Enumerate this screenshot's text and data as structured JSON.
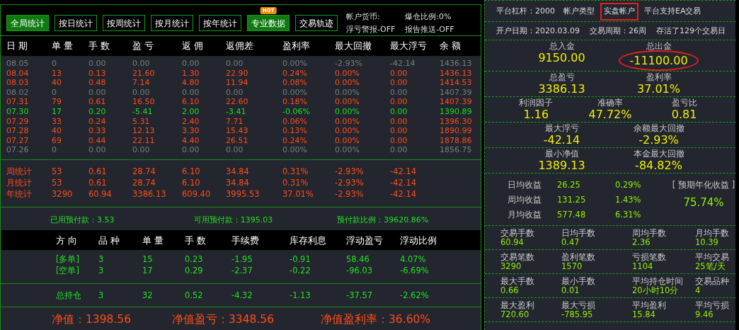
{
  "toolbar": {
    "tabs": [
      {
        "label": "全局统计",
        "selected": true
      },
      {
        "label": "按日统计",
        "selected": false
      },
      {
        "label": "按周统计",
        "selected": false
      },
      {
        "label": "按月统计",
        "selected": false
      },
      {
        "label": "按年统计",
        "selected": false
      },
      {
        "label": "专业数据",
        "selected": true,
        "badge": "HOT"
      },
      {
        "label": "交易轨迹",
        "selected": false
      }
    ],
    "info": [
      "帐户货币:",
      "爆仓比例:0%",
      "浮亏警报-OFF",
      "报告推送-OFF"
    ]
  },
  "daily_table": {
    "columns": [
      "日 期",
      "单 量",
      "手 数",
      "盈 亏",
      "返 佣",
      "返佣差",
      "盈利率",
      "最大回撤",
      "最大浮亏",
      "余 额"
    ],
    "rows": [
      {
        "kind": "flat",
        "cells": [
          "08.05",
          "0",
          "0.00",
          "0.00",
          "0.00",
          "0.00",
          "0.00%",
          "-2.93%",
          "-42.14",
          "1436.13"
        ]
      },
      {
        "kind": "gain",
        "cells": [
          "08.04",
          "13",
          "0.13",
          "21.60",
          "1.30",
          "22.90",
          "0.24%",
          "0.00%",
          "0.00",
          "1436.13"
        ]
      },
      {
        "kind": "gain",
        "cells": [
          "08.03",
          "40",
          "0.48",
          "7.14",
          "4.80",
          "11.94",
          "0.08%",
          "0.00%",
          "0.00",
          "1414.53"
        ]
      },
      {
        "kind": "flat",
        "cells": [
          "08.02",
          "0",
          "0.00",
          "0.00",
          "0.00",
          "0.00",
          "0.00%",
          "0.00%",
          "0.00",
          "1407.39"
        ]
      },
      {
        "kind": "gain",
        "cells": [
          "07.31",
          "79",
          "0.61",
          "16.50",
          "6.10",
          "22.60",
          "0.18%",
          "0.00%",
          "0.00",
          "1407.39"
        ]
      },
      {
        "kind": "loss",
        "cells": [
          "07.30",
          "17",
          "0.20",
          "-5.41",
          "2.00",
          "-3.41",
          "-0.06%",
          "0.00%",
          "0.00",
          "1390.89"
        ]
      },
      {
        "kind": "gain",
        "cells": [
          "07.29",
          "33",
          "0.24",
          "5.31",
          "2.40",
          "7.71",
          "0.06%",
          "0.00%",
          "0.00",
          "1396.30"
        ]
      },
      {
        "kind": "gain",
        "cells": [
          "07.28",
          "40",
          "0.33",
          "12.13",
          "3.30",
          "15.43",
          "0.13%",
          "0.00%",
          "0.00",
          "1890.99"
        ]
      },
      {
        "kind": "gain",
        "cells": [
          "07.27",
          "69",
          "0.44",
          "22.11",
          "4.40",
          "26.51",
          "0.24%",
          "0.00%",
          "0.00",
          "1878.86"
        ]
      },
      {
        "kind": "flat",
        "cells": [
          "07.26",
          "0",
          "0.00",
          "0.00",
          "0.00",
          "0.00",
          "0.00%",
          "0.00%",
          "0.00",
          "1856.75"
        ]
      }
    ],
    "summary": [
      {
        "cells": [
          "周统计",
          "53",
          "0.61",
          "28.74",
          "6.10",
          "34.84",
          "0.31%",
          "-2.93%",
          "-42.14"
        ]
      },
      {
        "cells": [
          "月统计",
          "53",
          "0.61",
          "28.74",
          "6.10",
          "34.84",
          "0.31%",
          "-2.93%",
          "-42.14"
        ]
      },
      {
        "cells": [
          "年统计",
          "3290",
          "60.94",
          "3386.13",
          "609.40",
          "3995.53",
          "37.01%",
          "-2.93%",
          "-42.14"
        ]
      }
    ]
  },
  "prepaid": [
    "已用预付款：3.53",
    "可用预付款：1395.03",
    "预付款比例：39620.86%"
  ],
  "positions": {
    "columns": [
      "方 向",
      "品 种",
      "单 量",
      "手 数",
      "手续费",
      "库存利息",
      "浮动盈亏",
      "浮动比例"
    ],
    "rows": [
      {
        "cells": [
          "[多单]",
          "3",
          "15",
          "0.23",
          "-1.95",
          "-0.91",
          "58.46",
          "4.07%"
        ]
      },
      {
        "cells": [
          "[空单]",
          "3",
          "17",
          "0.29",
          "-2.37",
          "-0.22",
          "-96.03",
          "-6.69%"
        ]
      }
    ],
    "total": {
      "cells": [
        "总持仓",
        "3",
        "32",
        "0.52",
        "-4.32",
        "-1.13",
        "-37.57",
        "-2.62%"
      ]
    }
  },
  "net": [
    "净值：1398.56",
    "净值盈亏：3348.56",
    "净值盈利率：36.60%"
  ],
  "account": {
    "header": [
      {
        "text": "平台杠杆：2000",
        "boxed": false
      },
      {
        "text": "帐户类型",
        "boxed": false
      },
      {
        "text": "实盘帐户",
        "boxed": true
      },
      {
        "text": "平台支持EA交易",
        "boxed": false
      }
    ],
    "dates": [
      "开户日期：2020.03.09",
      "交易周期：26周",
      "存活了129个交易日"
    ],
    "big_stats": [
      [
        {
          "label": "总入金",
          "value": "9150.00",
          "circled": false
        },
        {
          "label": "总出金",
          "value": "-11100.00",
          "circled": true
        }
      ],
      [
        {
          "label": "总盈亏",
          "value": "3386.13",
          "circled": false
        },
        {
          "label": "盈利率",
          "value": "37.01%",
          "circled": false
        }
      ],
      [
        {
          "label": "利润因子",
          "value": "1.16",
          "circled": false
        },
        {
          "label": "准确率",
          "value": "47.72%",
          "circled": false
        },
        {
          "label": "盈亏比",
          "value": "0.81",
          "circled": false
        }
      ],
      [
        {
          "label": "最大浮亏",
          "value": "-42.14",
          "circled": false
        },
        {
          "label": "余额最大回撤",
          "value": "-2.93%",
          "circled": false
        }
      ],
      [
        {
          "label": "最小净值",
          "value": "1389.13",
          "circled": false
        },
        {
          "label": "本金最大回撤",
          "value": "-84.82%",
          "circled": false
        }
      ]
    ],
    "averages": [
      {
        "label": "日均收益",
        "amount": "26.25",
        "percent": "0.29%"
      },
      {
        "label": "周均收益",
        "amount": "131.25",
        "percent": "1.43%"
      },
      {
        "label": "月均收益",
        "amount": "577.48",
        "percent": "6.31%"
      }
    ],
    "forecast": {
      "label": "[ 预期年化收益 ]",
      "value": "75.74%"
    },
    "counts": [
      [
        {
          "label": "交易手数",
          "value": "60.94"
        },
        {
          "label": "日均手数",
          "value": "0.47"
        },
        {
          "label": "周均手数",
          "value": "2.36"
        },
        {
          "label": "月均手数",
          "value": "10.39"
        }
      ],
      [
        {
          "label": "交易笔数",
          "value": "3290"
        },
        {
          "label": "盈利笔数",
          "value": "1570"
        },
        {
          "label": "亏损笔数",
          "value": "1104"
        },
        {
          "label": "平均交易",
          "value": "25笔/天"
        }
      ],
      [
        {
          "label": "最大手数",
          "value": "0.66"
        },
        {
          "label": "最小手数",
          "value": "0.01"
        },
        {
          "label": "平均持仓时间",
          "value": "20小时10分"
        },
        {
          "label": "交易品种",
          "value": "4"
        }
      ],
      [
        {
          "label": "最大盈利",
          "value": "720.60"
        },
        {
          "label": "最大亏损",
          "value": "-785.95"
        },
        {
          "label": "平均盈利",
          "value": "15.84"
        },
        {
          "label": "平均亏损",
          "value": "9.46"
        }
      ]
    ]
  }
}
